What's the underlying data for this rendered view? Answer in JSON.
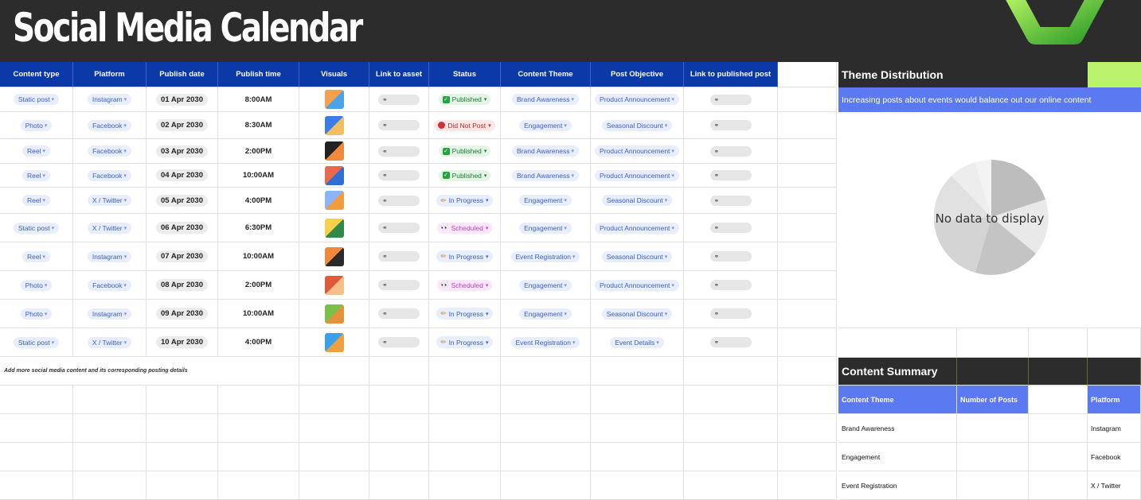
{
  "title": "Social Media Calendar",
  "columns": [
    "Content type",
    "Platform",
    "Publish date",
    "Publish time",
    "Visuals",
    "Link to asset",
    "Status",
    "Content Theme",
    "Post Objective",
    "Link to published post"
  ],
  "rows": [
    {
      "type": "Static post",
      "platform": "Instagram",
      "date": "01 Apr 2030",
      "time": "8:00AM",
      "status": "Published",
      "status_kind": "published",
      "theme": "Brand Awareness",
      "objective": "Product Announcement"
    },
    {
      "type": "Photo",
      "platform": "Facebook",
      "date": "02 Apr 2030",
      "time": "8:30AM",
      "status": "Did Not Post",
      "status_kind": "notpost",
      "theme": "Engagement",
      "objective": "Seasonal Discount"
    },
    {
      "type": "Reel",
      "platform": "Facebook",
      "date": "03 Apr 2030",
      "time": "2:00PM",
      "status": "Published",
      "status_kind": "published",
      "theme": "Brand Awareness",
      "objective": "Product Announcement"
    },
    {
      "type": "Reel",
      "platform": "Facebook",
      "date": "04 Apr 2030",
      "time": "10:00AM",
      "status": "Published",
      "status_kind": "published",
      "theme": "Brand Awareness",
      "objective": "Product Announcement"
    },
    {
      "type": "Reel",
      "platform": "X / Twitter",
      "date": "05 Apr 2030",
      "time": "4:00PM",
      "status": "In Progress",
      "status_kind": "progress",
      "theme": "Engagement",
      "objective": "Seasonal Discount"
    },
    {
      "type": "Static post",
      "platform": "X / Twitter",
      "date": "06 Apr 2030",
      "time": "6:30PM",
      "status": "Scheduled",
      "status_kind": "scheduled",
      "theme": "Engagement",
      "objective": "Product Announcement"
    },
    {
      "type": "Reel",
      "platform": "Instagram",
      "date": "07 Apr 2030",
      "time": "10:00AM",
      "status": "In Progress",
      "status_kind": "progress",
      "theme": "Event Registration",
      "objective": "Seasonal Discount"
    },
    {
      "type": "Photo",
      "platform": "Facebook",
      "date": "08 Apr 2030",
      "time": "2:00PM",
      "status": "Scheduled",
      "status_kind": "scheduled",
      "theme": "Engagement",
      "objective": "Product Announcement"
    },
    {
      "type": "Photo",
      "platform": "Instagram",
      "date": "09 Apr 2030",
      "time": "10:00AM",
      "status": "In Progress",
      "status_kind": "progress",
      "theme": "Engagement",
      "objective": "Seasonal Discount"
    },
    {
      "type": "Static post",
      "platform": "X / Twitter",
      "date": "10 Apr 2030",
      "time": "4:00PM",
      "status": "In Progress",
      "status_kind": "progress",
      "theme": "Event Registration",
      "objective": "Event Details"
    }
  ],
  "note": "Add more social media content and its corresponding posting details",
  "theme_distribution": {
    "title": "Theme Distribution",
    "note": "Increasing posts about events would balance out our online content",
    "empty_message": "No data to display"
  },
  "content_summary": {
    "title": "Content Summary",
    "col_theme": "Content Theme",
    "col_posts": "Number of Posts",
    "col_platform": "Platform",
    "themes": [
      "Brand Awareness",
      "Engagement",
      "Event Registration"
    ],
    "platforms": [
      "Instagram",
      "Facebook",
      "X / Twitter"
    ]
  },
  "colors": {
    "header": "#0b3aa8",
    "banner": "#2c2c2c",
    "accent": "#b9f26b",
    "note_bg": "#5b79f0"
  },
  "icons": {
    "link": "link-icon",
    "published": "check-icon",
    "notpost": "stop-icon",
    "progress": "pencil-icon",
    "scheduled": "eyes-icon"
  }
}
